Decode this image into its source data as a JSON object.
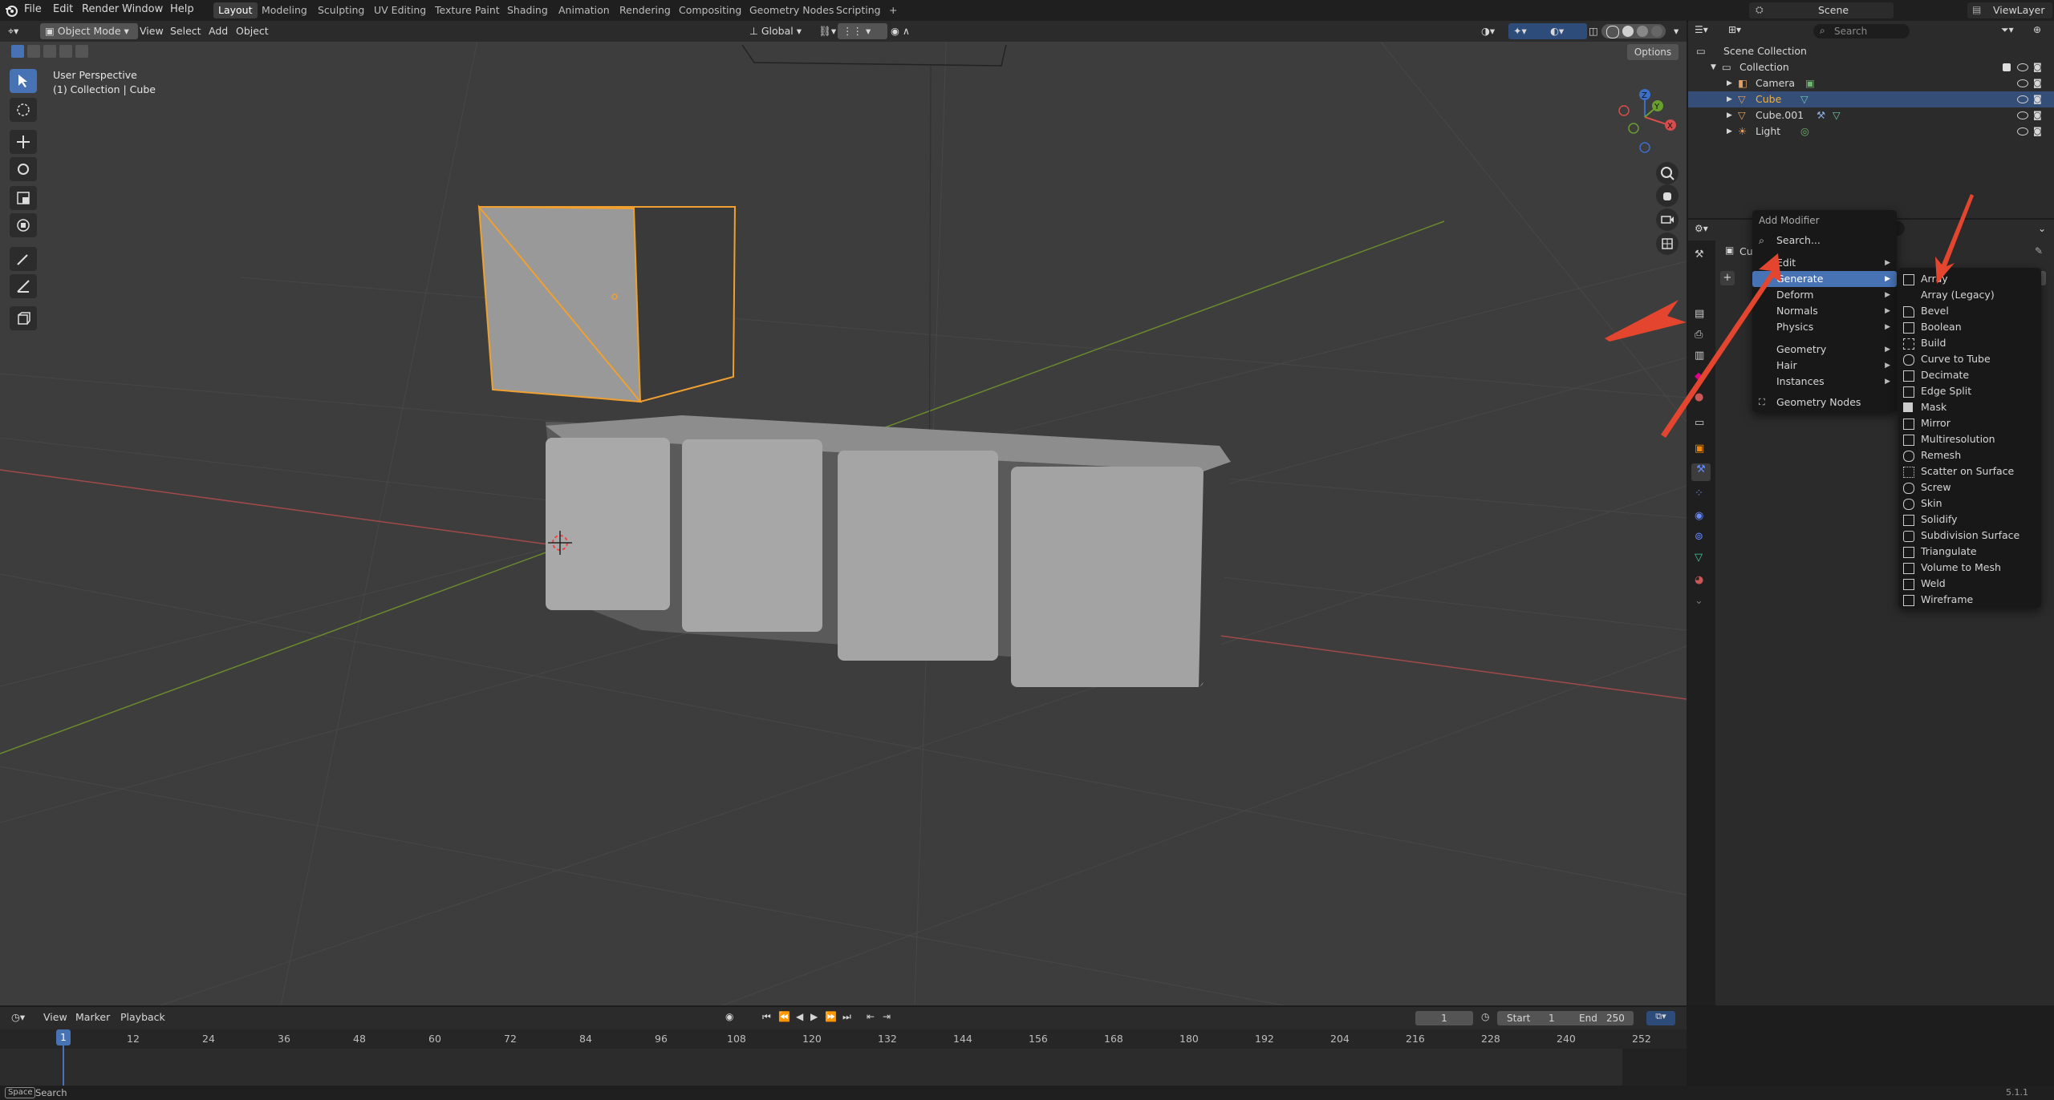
{
  "topbar": {
    "menus": [
      "File",
      "Edit",
      "Render",
      "Window",
      "Help"
    ],
    "workspaces": [
      "Layout",
      "Modeling",
      "Sculpting",
      "UV Editing",
      "Texture Paint",
      "Shading",
      "Animation",
      "Rendering",
      "Compositing",
      "Geometry Nodes",
      "Scripting"
    ],
    "active_workspace": "Layout",
    "add_tab": "+",
    "scene": "Scene",
    "view_layer": "ViewLayer"
  },
  "viewport_header": {
    "mode": "Object Mode",
    "menus": [
      "View",
      "Select",
      "Add",
      "Object"
    ],
    "orientation": "Global",
    "options": "Options"
  },
  "viewport": {
    "perspective": "User Perspective",
    "context": "(1) Collection | Cube"
  },
  "outliner": {
    "search_placeholder": "Search",
    "scene_collection": "Scene Collection",
    "collection": "Collection",
    "items": [
      {
        "name": "Camera",
        "selected": false
      },
      {
        "name": "Cube",
        "selected": true
      },
      {
        "name": "Cube.001",
        "selected": false
      },
      {
        "name": "Light",
        "selected": false
      }
    ]
  },
  "properties": {
    "object_name": "Cu"
  },
  "add_modifier_menu": {
    "title": "Add Modifier",
    "search": "Search...",
    "items": [
      "Edit",
      "Generate",
      "Deform",
      "Normals",
      "Physics",
      "Geometry",
      "Hair",
      "Instances"
    ],
    "highlighted": "Generate",
    "geometry_nodes": "Geometry Nodes"
  },
  "generate_submenu": {
    "items": [
      "Array",
      "Array (Legacy)",
      "Bevel",
      "Boolean",
      "Build",
      "Curve to Tube",
      "Decimate",
      "Edge Split",
      "Mask",
      "Mirror",
      "Multiresolution",
      "Remesh",
      "Scatter on Surface",
      "Screw",
      "Skin",
      "Solidify",
      "Subdivision Surface",
      "Triangulate",
      "Volume to Mesh",
      "Weld",
      "Wireframe"
    ]
  },
  "timeline": {
    "menus": [
      "View",
      "Marker",
      "Playback"
    ],
    "current_frame": "1",
    "start_label": "Start",
    "start": "1",
    "end_label": "End",
    "end": "250",
    "ticks": [
      "1",
      "12",
      "24",
      "36",
      "48",
      "60",
      "72",
      "84",
      "96",
      "108",
      "120",
      "132",
      "144",
      "156",
      "168",
      "180",
      "192",
      "204",
      "216",
      "228",
      "240",
      "252"
    ]
  },
  "statusbar": {
    "key": "Space",
    "action": "Search",
    "version": "5.1.1"
  },
  "colors": {
    "selection": "#f0a030",
    "accent": "#4772b3",
    "arrow": "#e4452f"
  }
}
